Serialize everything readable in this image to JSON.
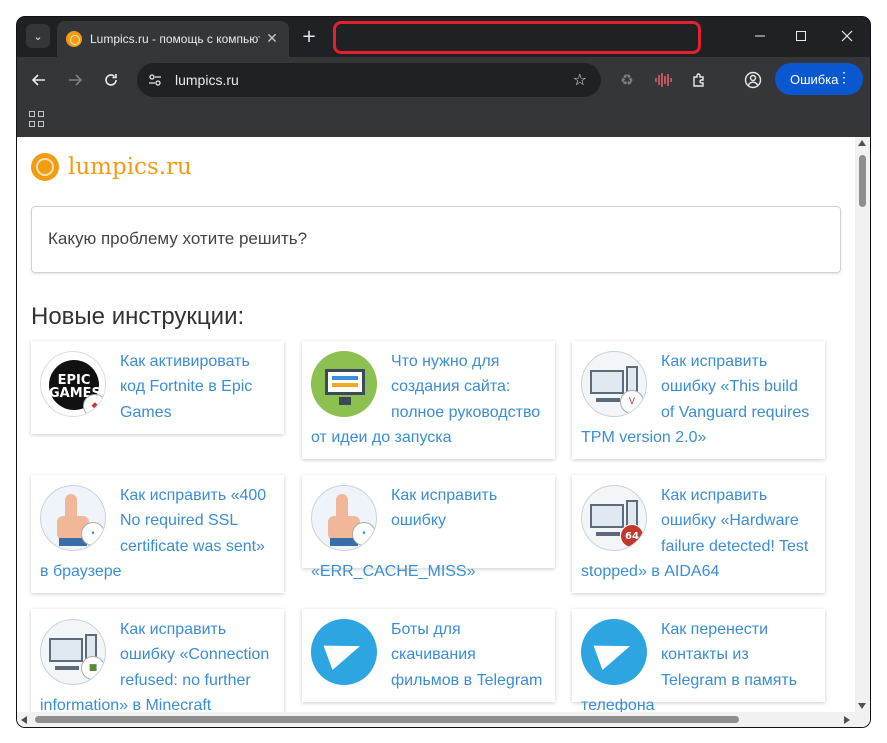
{
  "browser": {
    "tab_title": "Lumpics.ru - помощь с компьютером",
    "tab_close": "✕",
    "new_tab": "+",
    "url": "lumpics.ru",
    "profile_label": "Ошибка",
    "accent": "#0b57d0",
    "highlight_color": "#e5202e"
  },
  "page": {
    "logo_text": "lumpics.ru",
    "search_placeholder": "Какую проблему хотите решить?",
    "section_title": "Новые инструкции:",
    "cards": [
      {
        "title": "Как активировать код Fortnite в Epic Games",
        "thumb": "epic-games-icon",
        "thumb_text": "EPIC GAMES"
      },
      {
        "title": "Что нужно для создания сайта: полное руководство от идеи до запуска",
        "thumb": "website-monitor-icon"
      },
      {
        "title": "Как исправить ошибку «This build of Vanguard requires TPM version 2.0»",
        "thumb": "computer-icon"
      },
      {
        "title": "Как исправить «400 No required SSL certificate was sent» в браузере",
        "thumb": "hand-pointer-icon"
      },
      {
        "title": "Как исправить ошибку «ERR_CACHE_MISS»",
        "thumb": "hand-pointer-icon"
      },
      {
        "title": "Как исправить ошибку «Hardware failure detected! Test stopped» в AIDA64",
        "thumb": "computer-icon",
        "badge_text": "64"
      },
      {
        "title": "Как исправить ошибку «Connection refused: no further information» в Minecraft",
        "thumb": "computer-icon"
      },
      {
        "title": "Боты для скачивания фильмов в Telegram",
        "thumb": "telegram-icon"
      },
      {
        "title": "Как перенести контакты из Telegram в память телефона",
        "thumb": "telegram-icon"
      }
    ],
    "link_color": "#3a8dd6",
    "logo_color": "#f39c12"
  }
}
